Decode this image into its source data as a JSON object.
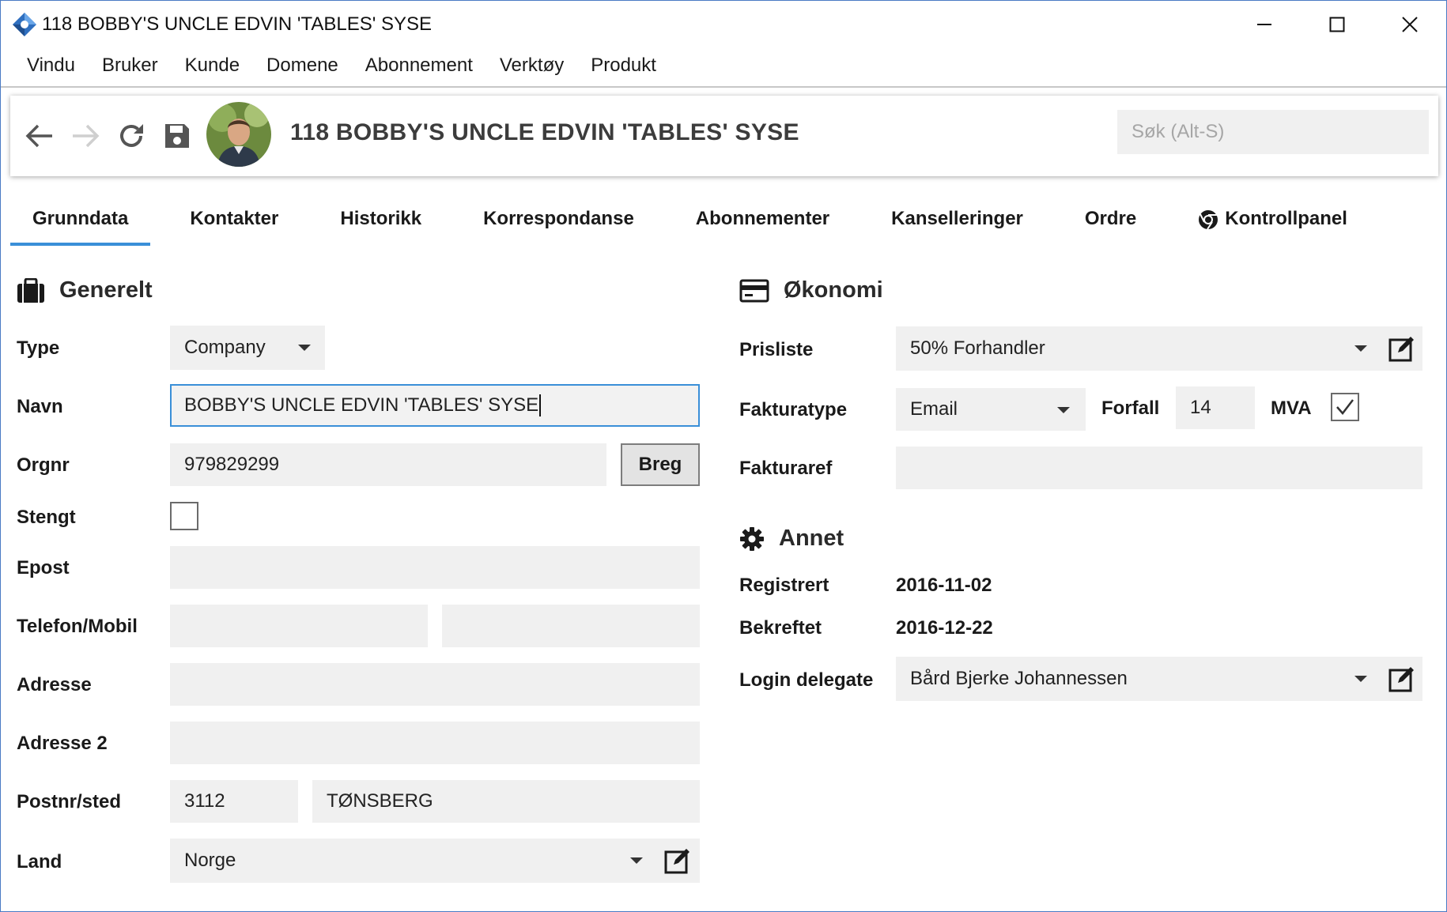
{
  "window": {
    "title": "118 BOBBY'S UNCLE EDVIN 'TABLES' SYSE"
  },
  "menu": [
    "Vindu",
    "Bruker",
    "Kunde",
    "Domene",
    "Abonnement",
    "Verktøy",
    "Produkt"
  ],
  "toolbar": {
    "record_title": "118 BOBBY'S UNCLE EDVIN 'TABLES' SYSE",
    "search_placeholder": "Søk (Alt-S)",
    "buttons": [
      "back-icon",
      "forward-icon",
      "refresh-icon",
      "save-icon"
    ]
  },
  "tabs": [
    {
      "label": "Grunndata",
      "active": true
    },
    {
      "label": "Kontakter"
    },
    {
      "label": "Historikk"
    },
    {
      "label": "Korrespondanse"
    },
    {
      "label": "Abonnementer"
    },
    {
      "label": "Kanselleringer"
    },
    {
      "label": "Ordre"
    },
    {
      "label": "Kontrollpanel",
      "icon": "chrome-icon"
    }
  ],
  "generelt": {
    "heading": "Generelt",
    "type_label": "Type",
    "type_value": "Company",
    "navn_label": "Navn",
    "navn_value": "BOBBY'S UNCLE EDVIN 'TABLES' SYSE",
    "orgnr_label": "Orgnr",
    "orgnr_value": "979829299",
    "breg_button": "Breg",
    "stengt_label": "Stengt",
    "stengt_checked": false,
    "epost_label": "Epost",
    "epost_value": "",
    "telefon_label": "Telefon/Mobil",
    "telefon_value": "",
    "mobil_value": "",
    "adresse_label": "Adresse",
    "adresse_value": "",
    "adresse2_label": "Adresse 2",
    "adresse2_value": "",
    "postnr_label": "Postnr/sted",
    "postnr_value": "3112",
    "sted_value": "TØNSBERG",
    "land_label": "Land",
    "land_value": "Norge"
  },
  "okonomi": {
    "heading": "Økonomi",
    "prisliste_label": "Prisliste",
    "prisliste_value": "50% Forhandler",
    "fakturatype_label": "Fakturatype",
    "fakturatype_value": "Email",
    "forfall_label": "Forfall",
    "forfall_value": "14",
    "mva_label": "MVA",
    "mva_checked": true,
    "fakturaref_label": "Fakturaref",
    "fakturaref_value": ""
  },
  "annet": {
    "heading": "Annet",
    "registrert_label": "Registrert",
    "registrert_value": "2016-11-02",
    "bekreftet_label": "Bekreftet",
    "bekreftet_value": "2016-12-22",
    "login_label": "Login delegate",
    "login_value": "Bård Bjerke Johannessen"
  },
  "colors": {
    "accent": "#3a8fd8",
    "field_bg": "#f0f0f0",
    "border": "#4a7bc4"
  }
}
